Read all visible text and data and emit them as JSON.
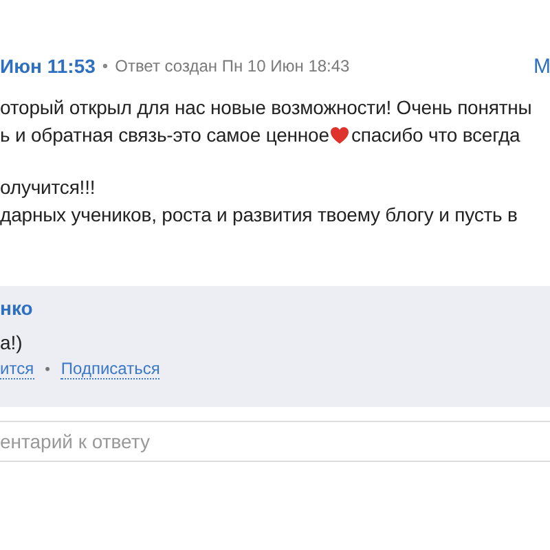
{
  "comment": {
    "author_date": "Июн 11:53",
    "answer_created": "Ответ создан Пн 10 Июн 18:43",
    "separator": "•",
    "menu_link": "М",
    "lines": [
      {
        "kind": "text",
        "text": "оторый открыл для нас новые возможности! Очень понятны"
      },
      {
        "kind": "heart",
        "before": "ь и обратная связь-это самое ценное",
        "after": " спасибо что всегда"
      },
      {
        "kind": "blank"
      },
      {
        "kind": "text",
        "text": "олучится!!!"
      },
      {
        "kind": "text",
        "text": "дарных учеников, роста и развития твоему блогу и пусть в"
      }
    ]
  },
  "reply": {
    "author": "нко",
    "text": "а!)",
    "actions": [
      "ится",
      "Подписаться"
    ],
    "separator": "•"
  },
  "comment_field": {
    "placeholder": "ентарий к ответу"
  }
}
